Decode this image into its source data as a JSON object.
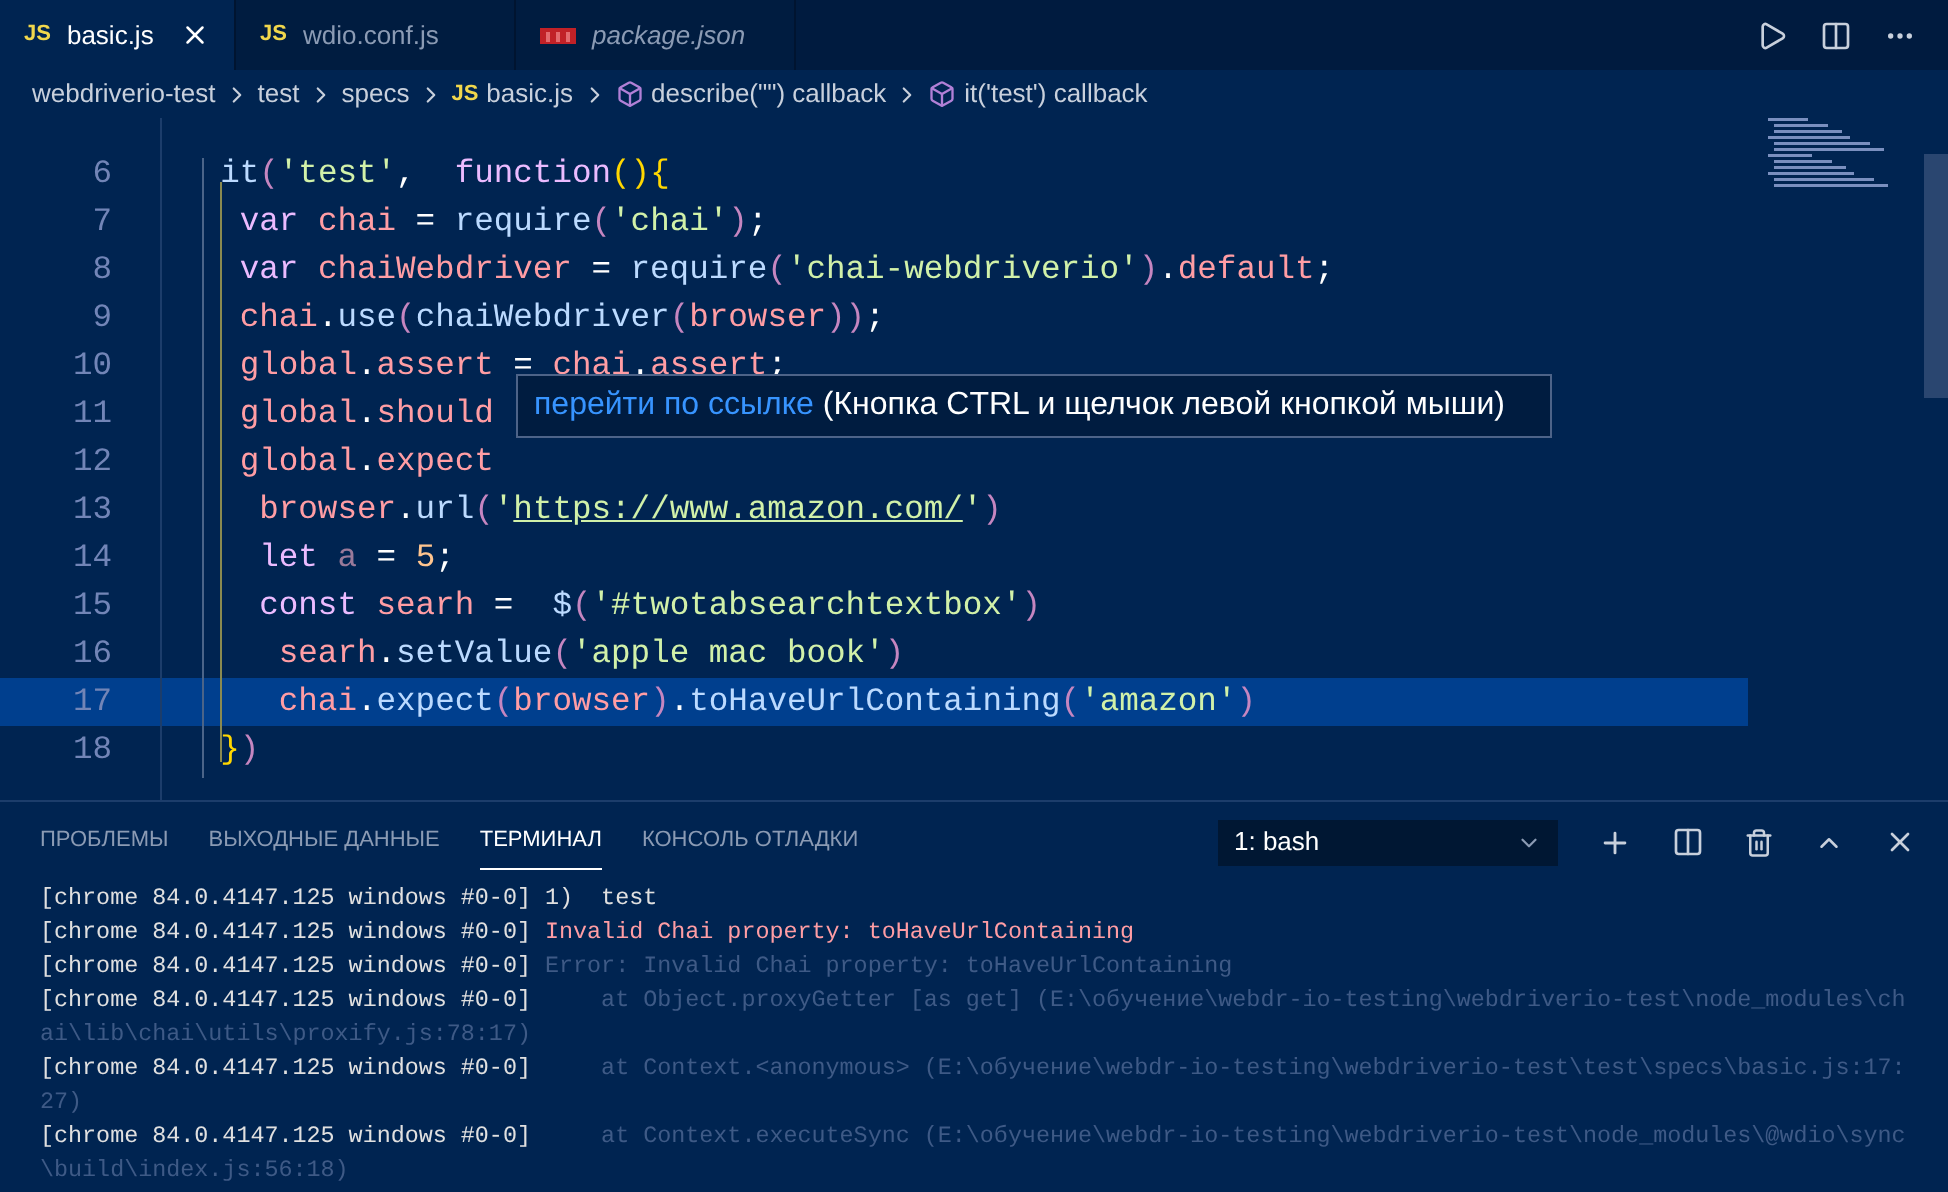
{
  "tabs": [
    {
      "kind": "js",
      "badge": "JS",
      "label": "basic.js",
      "selected": true,
      "preview": false
    },
    {
      "kind": "js",
      "badge": "JS",
      "label": "wdio.conf.js",
      "selected": false,
      "preview": false
    },
    {
      "kind": "npm",
      "label": "package.json",
      "selected": false,
      "preview": true
    }
  ],
  "breadcrumbs": [
    {
      "kind": "folder",
      "label": "webdriverio-test"
    },
    {
      "kind": "folder",
      "label": "test"
    },
    {
      "kind": "folder",
      "label": "specs"
    },
    {
      "kind": "js",
      "badge": "JS",
      "label": "basic.js"
    },
    {
      "kind": "symbol",
      "label": "describe(\"\") callback"
    },
    {
      "kind": "symbol",
      "label": "it('test') callback"
    }
  ],
  "editor": {
    "lines": [
      {
        "number": "6",
        "current": false,
        "tokens": [
          {
            "kind": "fn",
            "text": "    it"
          },
          {
            "kind": "paren",
            "text": "("
          },
          {
            "kind": "str",
            "text": "'test'"
          },
          {
            "kind": "plain",
            "text": ",  "
          },
          {
            "kind": "kw",
            "text": "function"
          },
          {
            "kind": "brace",
            "text": "()"
          },
          {
            "kind": "brace",
            "text": "{"
          }
        ]
      },
      {
        "number": "7",
        "current": false,
        "tokens": [
          {
            "kind": "kw",
            "text": "     var "
          },
          {
            "kind": "var",
            "text": "chai"
          },
          {
            "kind": "plain",
            "text": " = "
          },
          {
            "kind": "fn",
            "text": "require"
          },
          {
            "kind": "paren",
            "text": "("
          },
          {
            "kind": "str",
            "text": "'chai'"
          },
          {
            "kind": "paren",
            "text": ")"
          },
          {
            "kind": "plain",
            "text": ";"
          }
        ]
      },
      {
        "number": "8",
        "current": false,
        "tokens": [
          {
            "kind": "kw",
            "text": "     var "
          },
          {
            "kind": "var",
            "text": "chaiWebdriver"
          },
          {
            "kind": "plain",
            "text": " = "
          },
          {
            "kind": "fn",
            "text": "require"
          },
          {
            "kind": "paren",
            "text": "("
          },
          {
            "kind": "str",
            "text": "'chai-webdriverio'"
          },
          {
            "kind": "paren",
            "text": ")"
          },
          {
            "kind": "plain",
            "text": "."
          },
          {
            "kind": "var",
            "text": "default"
          },
          {
            "kind": "plain",
            "text": ";"
          }
        ]
      },
      {
        "number": "9",
        "current": false,
        "tokens": [
          {
            "kind": "var",
            "text": "     chai"
          },
          {
            "kind": "plain",
            "text": "."
          },
          {
            "kind": "fn",
            "text": "use"
          },
          {
            "kind": "paren",
            "text": "("
          },
          {
            "kind": "fn",
            "text": "chaiWebdriver"
          },
          {
            "kind": "paren",
            "text": "("
          },
          {
            "kind": "var",
            "text": "browser"
          },
          {
            "kind": "paren",
            "text": "))"
          },
          {
            "kind": "plain",
            "text": ";"
          }
        ]
      },
      {
        "number": "10",
        "current": false,
        "tokens": [
          {
            "kind": "var",
            "text": "     global"
          },
          {
            "kind": "plain",
            "text": "."
          },
          {
            "kind": "var",
            "text": "assert"
          },
          {
            "kind": "plain",
            "text": " = "
          },
          {
            "kind": "var",
            "text": "chai"
          },
          {
            "kind": "plain",
            "text": "."
          },
          {
            "kind": "var",
            "text": "assert"
          },
          {
            "kind": "plain",
            "text": ";"
          }
        ]
      },
      {
        "number": "11",
        "current": false,
        "tokens": [
          {
            "kind": "var",
            "text": "     global"
          },
          {
            "kind": "plain",
            "text": "."
          },
          {
            "kind": "var",
            "text": "should"
          }
        ]
      },
      {
        "number": "12",
        "current": false,
        "tokens": [
          {
            "kind": "var",
            "text": "     global"
          },
          {
            "kind": "plain",
            "text": "."
          },
          {
            "kind": "var",
            "text": "expect"
          }
        ]
      },
      {
        "number": "13",
        "current": false,
        "tokens": [
          {
            "kind": "var",
            "text": "      browser"
          },
          {
            "kind": "plain",
            "text": "."
          },
          {
            "kind": "fn",
            "text": "url"
          },
          {
            "kind": "paren",
            "text": "("
          },
          {
            "kind": "str",
            "text": "'"
          },
          {
            "kind": "link",
            "text": "https://www.amazon.com/"
          },
          {
            "kind": "str",
            "text": "'"
          },
          {
            "kind": "paren",
            "text": ")"
          }
        ]
      },
      {
        "number": "14",
        "current": false,
        "tokens": [
          {
            "kind": "kw",
            "text": "      let "
          },
          {
            "kind": "dim",
            "text": "a"
          },
          {
            "kind": "plain",
            "text": " = "
          },
          {
            "kind": "num",
            "text": "5"
          },
          {
            "kind": "plain",
            "text": ";"
          }
        ]
      },
      {
        "number": "15",
        "current": false,
        "tokens": [
          {
            "kind": "kw",
            "text": "      const "
          },
          {
            "kind": "var",
            "text": "searh"
          },
          {
            "kind": "plain",
            "text": " =  "
          },
          {
            "kind": "fn",
            "text": "$"
          },
          {
            "kind": "paren",
            "text": "("
          },
          {
            "kind": "str",
            "text": "'#twotabsearchtextbox'"
          },
          {
            "kind": "paren",
            "text": ")"
          }
        ]
      },
      {
        "number": "16",
        "current": false,
        "tokens": [
          {
            "kind": "var",
            "text": "       searh"
          },
          {
            "kind": "plain",
            "text": "."
          },
          {
            "kind": "fn",
            "text": "setValue"
          },
          {
            "kind": "paren",
            "text": "("
          },
          {
            "kind": "str",
            "text": "'apple mac book'"
          },
          {
            "kind": "paren",
            "text": ")"
          }
        ]
      },
      {
        "number": "17",
        "current": true,
        "tokens": [
          {
            "kind": "var",
            "text": "       chai"
          },
          {
            "kind": "plain",
            "text": "."
          },
          {
            "kind": "fn",
            "text": "expect"
          },
          {
            "kind": "paren",
            "text": "("
          },
          {
            "kind": "var",
            "text": "browser"
          },
          {
            "kind": "paren",
            "text": ")"
          },
          {
            "kind": "plain",
            "text": "."
          },
          {
            "kind": "fn",
            "text": "toHaveUrlContaining"
          },
          {
            "kind": "paren",
            "text": "("
          },
          {
            "kind": "str",
            "text": "'amazon'"
          },
          {
            "kind": "paren",
            "text": ")"
          }
        ]
      },
      {
        "number": "18",
        "current": false,
        "tokens": [
          {
            "kind": "brace",
            "text": "    }"
          },
          {
            "kind": "paren",
            "text": ")"
          }
        ]
      }
    ]
  },
  "hover": {
    "link": "перейти по ссылке",
    "text": "(Кнопка CTRL и щелчок левой кнопкой мыши)"
  },
  "panel": {
    "tabs": [
      {
        "label": "ПРОБЛЕМЫ",
        "selected": false
      },
      {
        "label": "ВЫХОДНЫЕ ДАННЫЕ",
        "selected": false
      },
      {
        "label": "ТЕРМИНАЛ",
        "selected": true
      },
      {
        "label": "КОНСОЛЬ ОТЛАДКИ",
        "selected": false
      }
    ],
    "terminal_select": "1: bash",
    "lines": [
      {
        "kind": "normal",
        "prefix": "[chrome 84.0.4147.125 windows #0-0]",
        "text": "1)  test"
      },
      {
        "kind": "error",
        "prefix": "[chrome 84.0.4147.125 windows #0-0]",
        "text": "Invalid Chai property: toHaveUrlContaining"
      },
      {
        "kind": "dim",
        "prefix": "[chrome 84.0.4147.125 windows #0-0]",
        "text": "Error: Invalid Chai property: toHaveUrlContaining"
      },
      {
        "kind": "dim",
        "prefix": "[chrome 84.0.4147.125 windows #0-0]",
        "text": "    at Object.proxyGetter [as get] (E:\\обучение\\webdr-io-testing\\webdriverio-test\\node_modules\\ch"
      },
      {
        "kind": "dim",
        "text": "ai\\lib\\chai\\utils\\proxify.js:78:17)"
      },
      {
        "kind": "dim",
        "prefix": "[chrome 84.0.4147.125 windows #0-0]",
        "text": "    at Context.<anonymous> (E:\\обучение\\webdr-io-testing\\webdriverio-test\\test\\specs\\basic.js:17:"
      },
      {
        "kind": "dim",
        "text": "27)"
      },
      {
        "kind": "dim",
        "prefix": "[chrome 84.0.4147.125 windows #0-0]",
        "text": "    at Context.executeSync (E:\\обучение\\webdr-io-testing\\webdriverio-test\\node_modules\\@wdio\\sync"
      },
      {
        "kind": "dim",
        "text": "\\build\\index.js:56:18)"
      }
    ]
  }
}
